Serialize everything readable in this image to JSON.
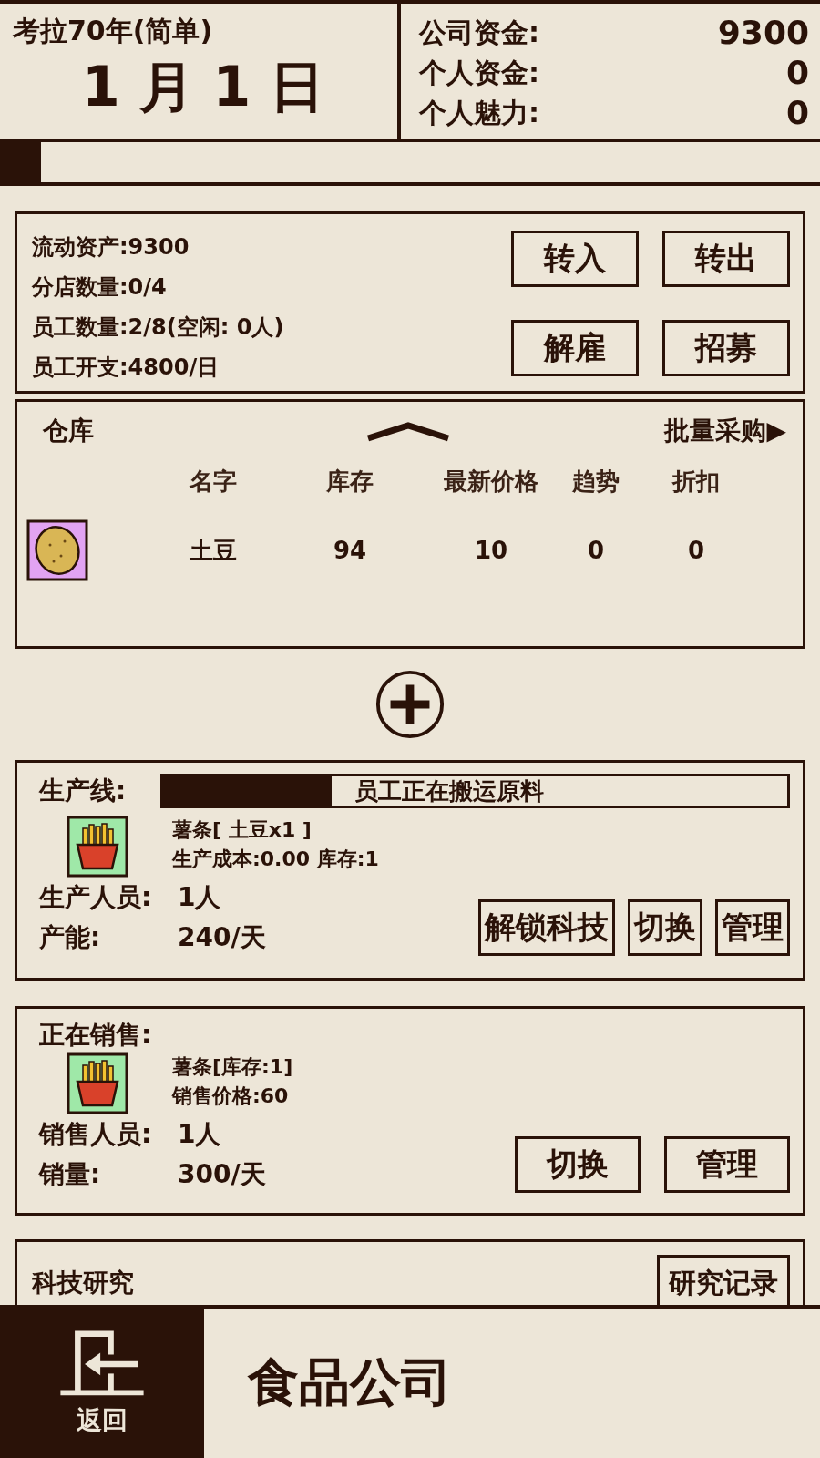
{
  "header": {
    "title": "考拉70年(简单)",
    "date": "1 月 1 日"
  },
  "funds": [
    {
      "label": "公司资金:",
      "value": "9300"
    },
    {
      "label": "个人资金:",
      "value": "0"
    },
    {
      "label": "个人魅力:",
      "value": "0"
    }
  ],
  "day_progress": {
    "level": 0.05
  },
  "finance": {
    "lines": [
      "流动资产:9300",
      "分店数量:0/4",
      "员工数量:2/8(空闲: 0人)",
      "员工开支:4800/日"
    ],
    "buttons": [
      "转入",
      "转出",
      "解雇",
      "招募"
    ]
  },
  "warehouse": {
    "title": "仓库",
    "bulk_buy": "批量采购▶",
    "columns": [
      "名字",
      "库存",
      "最新价格",
      "趋势",
      "折扣"
    ],
    "rows": [
      {
        "name": "土豆",
        "stock": "94",
        "price": "10",
        "trend": "0",
        "discount": "0"
      }
    ]
  },
  "production": {
    "title": "生产线:",
    "status": "员工正在搬运原料",
    "level": 0.27,
    "product": "薯条[ 土豆x1 ]",
    "detail": "生产成本:0.00 库存:1",
    "stats": [
      {
        "label": "生产人员:",
        "value": "1人"
      },
      {
        "label": "产能:",
        "value": "240/天"
      }
    ],
    "buttons": [
      "解锁科技",
      "切换",
      "管理"
    ]
  },
  "sales": {
    "title": "正在销售:",
    "product": "薯条[库存:1]",
    "detail": "销售价格:60",
    "stats": [
      {
        "label": "销售人员:",
        "value": "1人"
      },
      {
        "label": "销量:",
        "value": "300/天"
      }
    ],
    "buttons": [
      "切换",
      "管理"
    ]
  },
  "research": {
    "title": "科技研究",
    "button": "研究记录"
  },
  "footer": {
    "back": "返回",
    "title": "食品公司"
  }
}
